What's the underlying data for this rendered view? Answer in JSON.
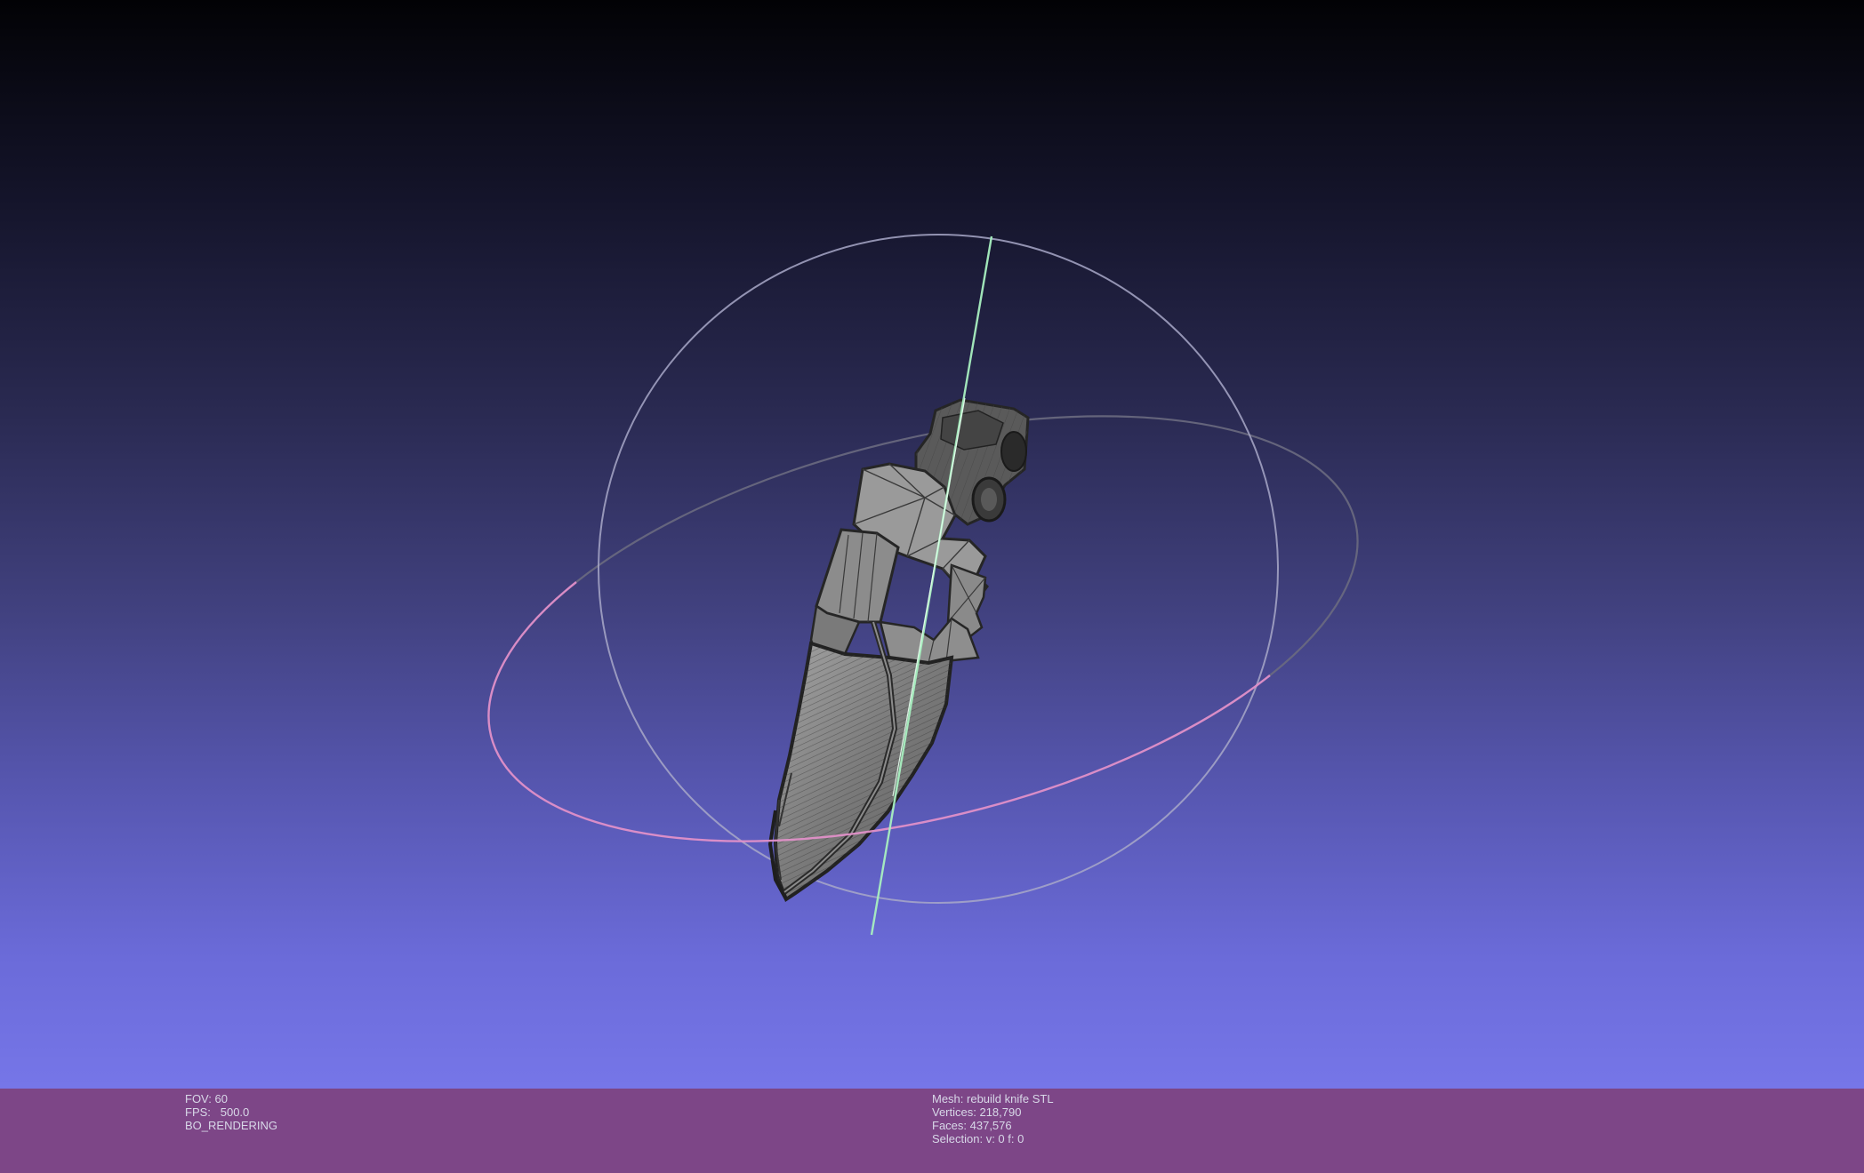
{
  "viewport": {
    "background_top": "#020205",
    "background_bottom": "#7676e8",
    "model_color": "#808080",
    "wire_color": "#3a3a3a",
    "trackball_colors": {
      "vertical_ring": "#a8a8c8",
      "horizontal_ring_front": "#e090c8",
      "horizontal_ring_back": "#6a6a80",
      "axis": "#a8f0c0"
    }
  },
  "status": {
    "left": {
      "fov": "FOV: 60",
      "fps": "FPS:   500.0",
      "mode": "BO_RENDERING"
    },
    "right": {
      "mesh": "Mesh: rebuild knife STL",
      "vertices": "Vertices: 218,790",
      "faces": "Faces: 437,576",
      "selection": "Selection: v: 0 f: 0"
    },
    "background": "#7d4687",
    "text_color": "#d8d8e8"
  }
}
